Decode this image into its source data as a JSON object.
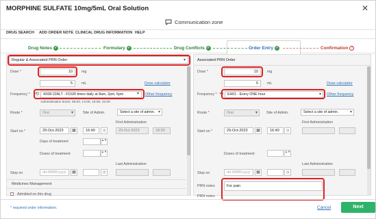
{
  "window": {
    "title": "MORPHINE SULFATE 10mg/5mL Oral Solution",
    "close": "✕"
  },
  "comm": {
    "label": "Communication zone"
  },
  "menu": {
    "items": [
      "DRUG SEARCH",
      "ADD ORDER NOTE",
      "CLINICAL DRUG INFORMATION",
      "HELP"
    ]
  },
  "steps": {
    "drug_notes": "Drug Notes",
    "formulary": "Formulary",
    "drug_conflicts": "Drug Conflicts",
    "order_entry": "Order Entry",
    "confirmation": "Confirmation",
    "check": "✓",
    "warn": "!"
  },
  "left": {
    "order_type": "Regular & Associated PRN Order",
    "dose_label": "Dose",
    "dose_value": "10",
    "dose_unit": "mg",
    "dose_ml_value": "5",
    "dose_ml_unit": "mL",
    "dose_calc": "Dose calculator",
    "freq_label": "Frequency",
    "freq_value": "4X08-22ALT - FOUR times daily at 8am, 2pm, 6pm",
    "other_freq": "Other frequency",
    "admin_times": "Administration times: 08:00, 14:00, 18:00, 22:00",
    "route_label": "Route",
    "route_value": "Oral",
    "site_label": "Site of Admin.",
    "site_value": "Select a site of admin.",
    "start_label": "Start on",
    "start_date": "29-Oct-2023",
    "start_time": "16:49",
    "first_admin_label": "First Administration",
    "first_admin_date": "29-Oct-2023",
    "first_admin_time": "18:00",
    "days_label": "Days of treatment",
    "doses_label": "Doses of treatment",
    "last_admin_label": "Last Administration",
    "stop_label": "Stop on",
    "stop_placeholder": "dd-MMM-yyyy",
    "meds_mgmt": "Medicines Management",
    "admitted": "Admitted on this drug"
  },
  "right": {
    "header": "Associated PRN Order",
    "dose_label": "Dose",
    "dose_value": "10",
    "dose_unit": "mg",
    "dose_ml_value": "5",
    "dose_ml_unit": "mL",
    "dose_calc": "Dose calculator",
    "freq_label": "Frequency",
    "freq_value": "EH01 - Every ONE hour",
    "other_freq": "Other frequency",
    "route_label": "Route",
    "route_value": "Oral",
    "site_label": "Site of Admin.",
    "site_value": "Select a site of admin.",
    "start_label": "Start on",
    "start_date": "29-Oct-2023",
    "start_time": "16:49",
    "first_admin_label": "First Administration",
    "doses_label": "Doses of treatment",
    "last_admin_label": "Last Administration",
    "stop_label": "Stop on",
    "stop_placeholder": "dd-MMM-yyyy",
    "prn_label": "PRN notes",
    "prn_value": "For pain",
    "prn_label2": "PRN notes"
  },
  "footer": {
    "note": "* required order information.",
    "cancel": "Cancel",
    "next": "Next"
  },
  "colors": {
    "accent": "#2f6fb5",
    "success": "#2fb36a",
    "error": "#e02020"
  }
}
